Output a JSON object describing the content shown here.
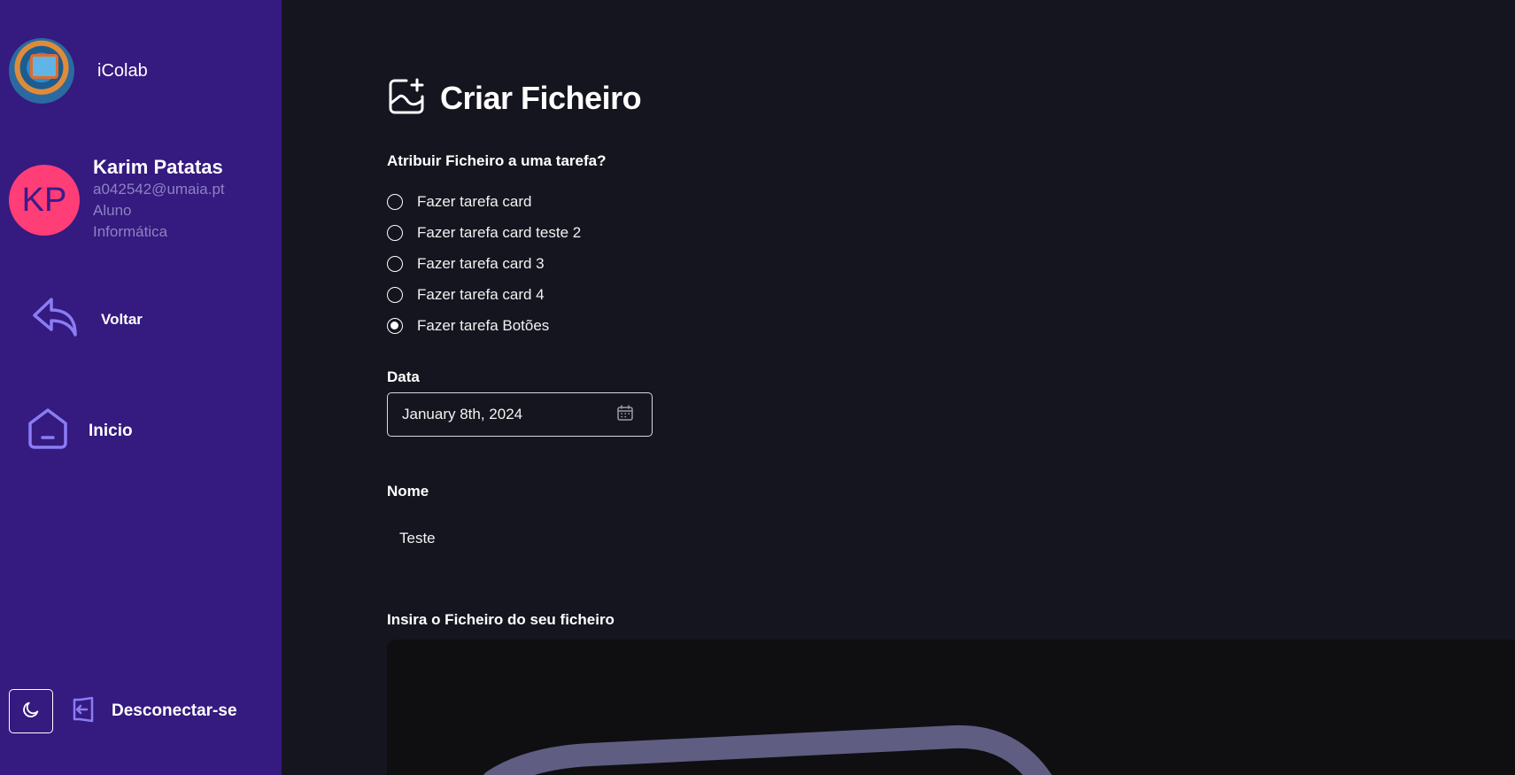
{
  "app": {
    "name": "iColab"
  },
  "user": {
    "initials": "KP",
    "name": "Karim Patatas",
    "email": "a042542@umaia.pt",
    "role": "Aluno",
    "course": "Informática"
  },
  "nav": {
    "back_label": "Voltar",
    "home_label": "Inicio",
    "logout_label": "Desconectar-se"
  },
  "page": {
    "title": "Criar Ficheiro",
    "task_question": "Atribuir Ficheiro a uma tarefa?",
    "tasks": [
      {
        "label": "Fazer tarefa card",
        "checked": false
      },
      {
        "label": "Fazer tarefa card teste 2",
        "checked": false
      },
      {
        "label": "Fazer tarefa card 3",
        "checked": false
      },
      {
        "label": "Fazer tarefa card 4",
        "checked": false
      },
      {
        "label": "Fazer tarefa Botões",
        "checked": true
      }
    ],
    "date_label": "Data",
    "date_value": "January 8th, 2024",
    "name_label": "Nome",
    "name_value": "Teste",
    "file_label": "Insira o Ficheiro do seu ficheiro"
  },
  "colors": {
    "sidebar_bg": "#351a7f",
    "main_bg": "#15151f",
    "avatar_bg": "#ff3d76",
    "accent_icon": "#8b7cf6"
  },
  "icons": {
    "back": "reply-arrow-icon",
    "home": "home-icon",
    "theme": "moon-icon",
    "logout": "logout-icon",
    "title": "image-plus-icon",
    "calendar": "calendar-icon"
  }
}
